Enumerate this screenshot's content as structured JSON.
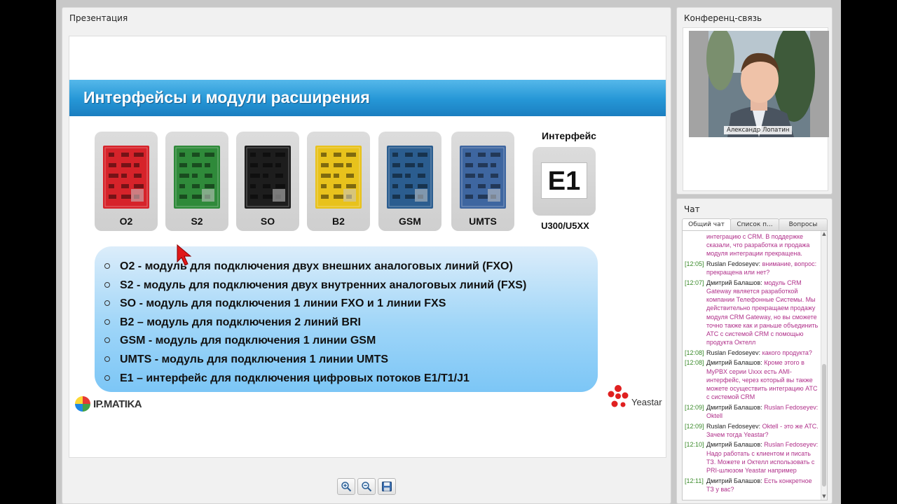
{
  "panels": {
    "presentation_title": "Презентация",
    "conference_title": "Конференц-связь",
    "chat_title": "Чат"
  },
  "slide": {
    "title": "Интерфейсы и модули расширения",
    "modules": [
      {
        "label": "O2",
        "color": "#d6232a"
      },
      {
        "label": "S2",
        "color": "#2f8a3a"
      },
      {
        "label": "SO",
        "color": "#1d1d1d"
      },
      {
        "label": "B2",
        "color": "#e8c21c"
      },
      {
        "label": "GSM",
        "color": "#2b5d8f"
      },
      {
        "label": "UMTS",
        "color": "#3e66a0"
      }
    ],
    "interface_heading": "Интерфейс",
    "interface_label": "E1",
    "interface_models": "U300/U5XX",
    "descriptions": [
      "O2 - модуль для подключения двух внешних аналоговых линий (FXO)",
      "S2 - модуль для подключения двух внутренних аналоговых линий (FXS)",
      "SO - модуль для подключения 1 линии FXO и 1 линии FXS",
      "B2 – модуль для подключения 2 линий BRI",
      "GSM - модуль для подключения 1 линии GSM",
      "UMTS - модуль для подключения 1 линии UMTS",
      "E1 – интерфейс для подключения цифровых потоков E1/T1/J1"
    ],
    "logo_left": "IP.MATIKA",
    "logo_right": "Yeastar"
  },
  "toolbar": {
    "zoom_in_icon": "zoom-in-icon",
    "zoom_out_icon": "zoom-out-icon",
    "save_icon": "save-icon"
  },
  "conference": {
    "participant_name": "Александр Лопатин"
  },
  "chat": {
    "tabs": [
      {
        "label": "Общий чат",
        "active": true
      },
      {
        "label": "Список п...",
        "active": false
      },
      {
        "label": "Вопросы",
        "active": false
      }
    ],
    "messages": [
      {
        "time": "",
        "author": "",
        "text": "интеграцию с CRM. В поддержке сказали, что разработка и продажа модуля интеграции прекращена."
      },
      {
        "time": "[12:05]",
        "author": "Ruslan Fedoseyev:",
        "text": "внимание, вопрос: прекращена или нет?"
      },
      {
        "time": "[12:07]",
        "author": "Дмитрий Балашов:",
        "text": "модуль CRM Gateway является разработкой компании Телефонные Системы. Мы действительно прекращаем продажу модуля CRM Gateway, но вы сможете точно также как и раньше объединить АТС с системой CRM с помощью продукта Октелл"
      },
      {
        "time": "[12:08]",
        "author": "Ruslan Fedoseyev:",
        "text": "какого продукта?"
      },
      {
        "time": "[12:08]",
        "author": "Дмитрий Балашов:",
        "text": "Кроме этого в MyPBX серии Uxxx есть AMI-интерфейс, через который вы также можете осуществить интеграцию АТС с системой CRM"
      },
      {
        "time": "[12:09]",
        "author": "Дмитрий Балашов:",
        "text": "Ruslan Fedoseyev: Oktell"
      },
      {
        "time": "[12:09]",
        "author": "Ruslan Fedoseyev:",
        "text": "Oktell - это же АТС. Зачем тогда Yeastar?"
      },
      {
        "time": "[12:10]",
        "author": "Дмитрий Балашов:",
        "text": "Ruslan Fedoseyev: Надо работать с клиентом и писать ТЗ. Можете и Октелл использовать с PRI-шлюзом Yeastar например"
      },
      {
        "time": "[12:11]",
        "author": "Дмитрий Балашов:",
        "text": "Есть конкретное ТЗ у вас?"
      }
    ]
  }
}
